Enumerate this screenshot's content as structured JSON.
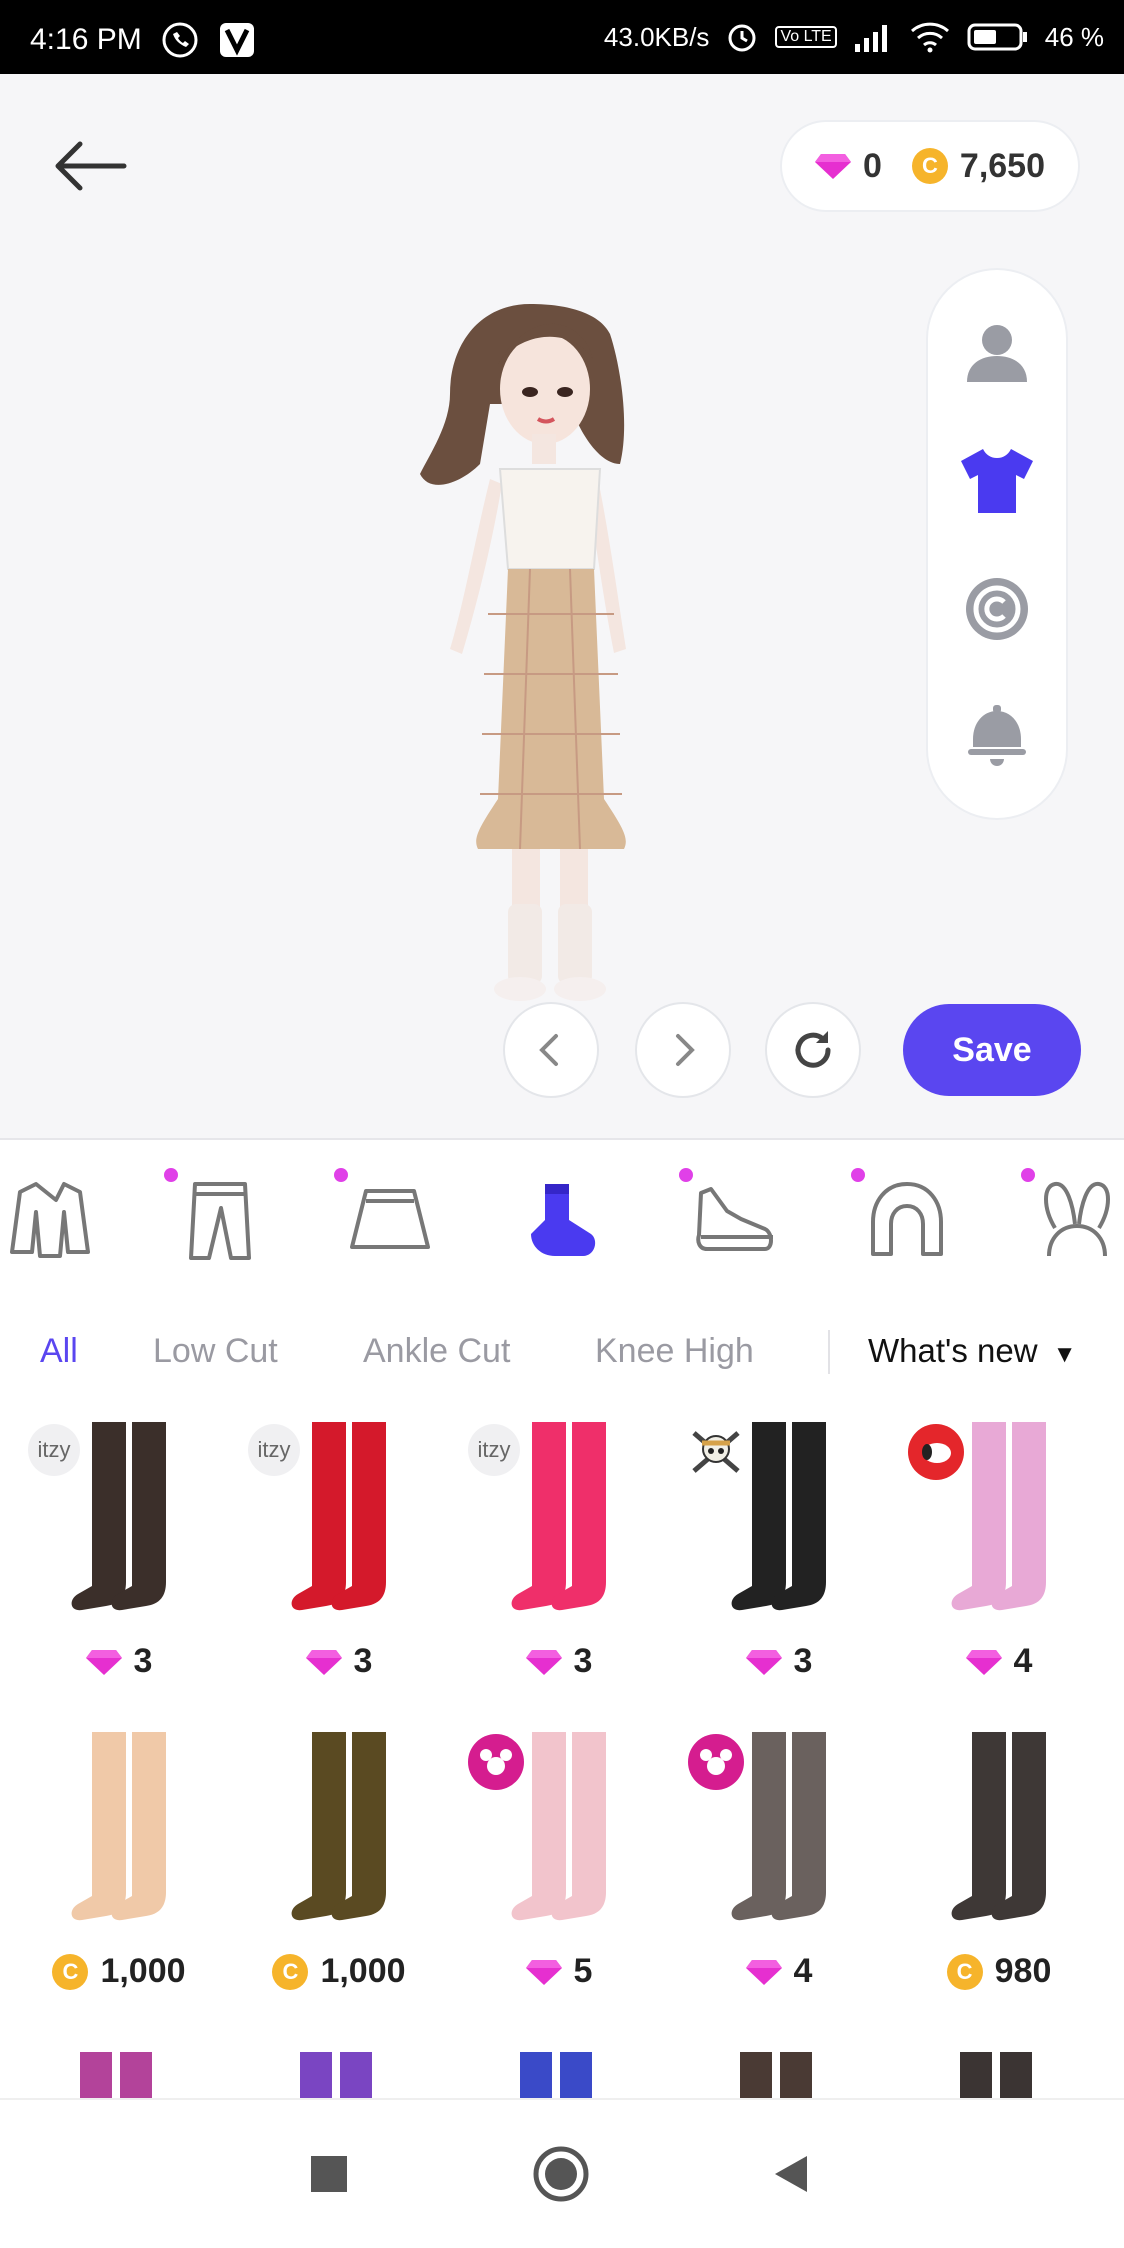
{
  "status_bar": {
    "time": "4:16 PM",
    "net_speed": "43.0KB/s",
    "volte": "Vo LTE",
    "battery": "46 %"
  },
  "wallet": {
    "gems": "0",
    "coins": "7,650"
  },
  "controls": {
    "save_label": "Save"
  },
  "categories": [
    {
      "name": "jacket",
      "dot": false
    },
    {
      "name": "pants",
      "dot": true
    },
    {
      "name": "skirt",
      "dot": true
    },
    {
      "name": "socks",
      "dot": false,
      "active": true
    },
    {
      "name": "shoes",
      "dot": true
    },
    {
      "name": "hair",
      "dot": true
    },
    {
      "name": "headwear",
      "dot": true
    }
  ],
  "filters": {
    "all": "All",
    "low_cut": "Low Cut",
    "ankle_cut": "Ankle Cut",
    "knee_high": "Knee High",
    "sort": "What's new",
    "active": "All"
  },
  "badges": {
    "itzy": "itzy"
  },
  "items": [
    {
      "price": "3",
      "currency": "gem",
      "badge": "itzy",
      "color": "#3b2f2a"
    },
    {
      "price": "3",
      "currency": "gem",
      "badge": "itzy",
      "color": "#d4192b"
    },
    {
      "price": "3",
      "currency": "gem",
      "badge": "itzy",
      "color": "#ef2f6a"
    },
    {
      "price": "3",
      "currency": "gem",
      "badge": "skull",
      "color": "#222222"
    },
    {
      "price": "4",
      "currency": "gem",
      "badge": "snoopy",
      "color": "#e8a9d6"
    },
    {
      "price": "1,000",
      "currency": "coin",
      "badge": "",
      "color": "#f0c9a8"
    },
    {
      "price": "1,000",
      "currency": "coin",
      "badge": "",
      "color": "#5a4a22"
    },
    {
      "price": "5",
      "currency": "gem",
      "badge": "mickey",
      "color": "#f2c4cc"
    },
    {
      "price": "4",
      "currency": "gem",
      "badge": "mickey",
      "color": "#6a615e"
    },
    {
      "price": "980",
      "currency": "coin",
      "badge": "",
      "color": "#3e3836"
    }
  ],
  "colors": {
    "accent": "#5a46f0",
    "gem": "#e62fd0",
    "coin": "#f6b42b",
    "notify_dot": "#e040e8"
  }
}
